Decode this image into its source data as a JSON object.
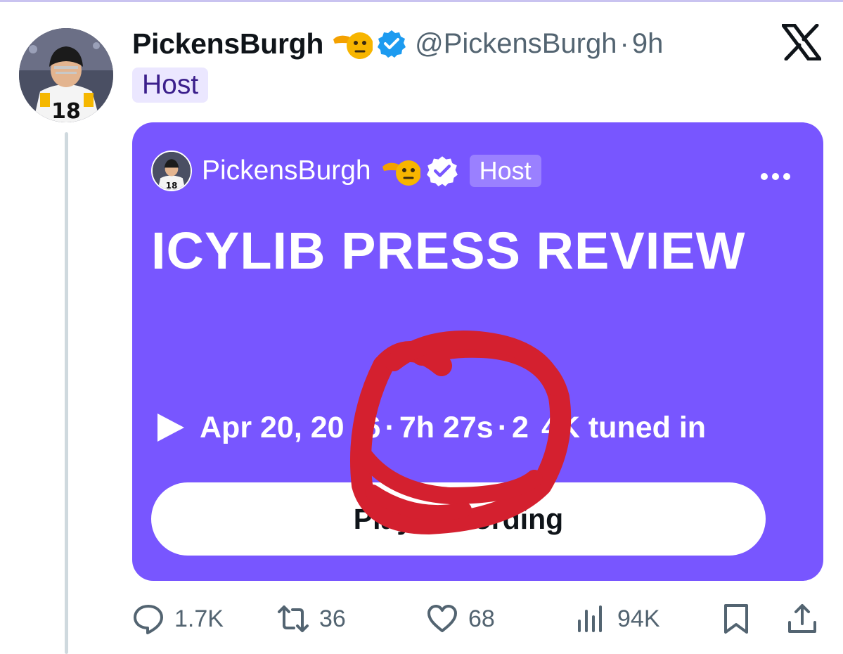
{
  "post": {
    "display_name": "PickensBurgh",
    "handle": "@PickensBurgh",
    "separator": "·",
    "time_ago": "9h",
    "role_badge": "Host",
    "icons": {
      "emoji": "saluting-face-emoji",
      "verified": "verified-badge-icon",
      "platform": "x-logo-icon"
    }
  },
  "space_card": {
    "host_name": "PickensBurgh",
    "host_badge": "Host",
    "title": "ICYLIB PRESS REVIEW",
    "meta": {
      "date": "Apr 20, 20",
      "date_tail": "6",
      "dot1": "·",
      "duration": "7h 27s",
      "dot2": "·",
      "listeners_head": "2",
      "listeners_tail": "4K tuned in"
    },
    "button_label": "Play Recording",
    "background_color": "#7856ff"
  },
  "actions": {
    "replies": "1.7K",
    "reposts": "36",
    "likes": "68",
    "views": "94K"
  },
  "annotation_color": "#d4202f"
}
